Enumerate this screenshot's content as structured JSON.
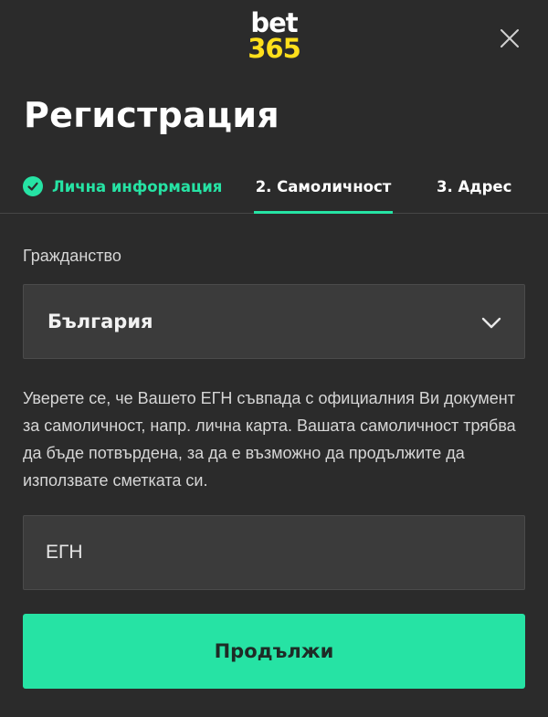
{
  "logo": {
    "line1": "bet",
    "line2": "365"
  },
  "header": {
    "title": "Регистрация"
  },
  "steps": [
    {
      "label": "Лична информация",
      "state": "done"
    },
    {
      "label": "2. Самоличност",
      "state": "active"
    },
    {
      "label": "3. Адрес",
      "state": "pending"
    }
  ],
  "form": {
    "citizenship_label": "Гражданство",
    "citizenship_value": "България",
    "info_text": "Уверете се, че Вашето ЕГН съвпада с официалния Ви документ за самоличност, напр. лична карта. Вашата самоличност трябва да бъде потвърдена, за да е възможно да продължите да използвате сметката си.",
    "egn_placeholder": "ЕГН",
    "egn_value": "",
    "submit_label": "Продължи"
  },
  "colors": {
    "accent": "#26e3a4",
    "logo_yellow": "#ffdf1b",
    "background": "#2b2b2b",
    "field_bg": "#3b3b3b"
  },
  "icons": {
    "close": "close-icon",
    "check": "check-circle-icon",
    "dropdown": "chevron-down-icon"
  }
}
